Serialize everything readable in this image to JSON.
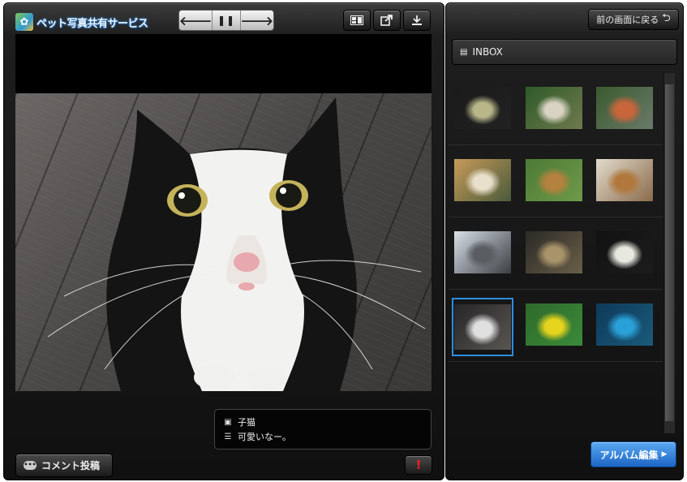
{
  "app": {
    "title": "ペット写真共有サービス"
  },
  "toolbar": {
    "prev_icon": "arrow-left-icon",
    "pause_icon": "pause-icon",
    "next_icon": "arrow-right-icon",
    "slideshow_icon": "slideshow-icon",
    "share_icon": "share-icon",
    "download_icon": "download-icon"
  },
  "photo": {
    "title": "子猫",
    "description": "可愛いなー。"
  },
  "footer": {
    "comment_label": "コメント投稿",
    "alert_label": "!"
  },
  "sidebar": {
    "back_label": "前の画面に戻る",
    "folder_label": "INBOX",
    "album_edit_label": "アルバム編集"
  },
  "thumbnails": [
    {
      "subject": "fish-tank-side",
      "colors": [
        "#1a1a1a",
        "#b9b78a",
        "#222"
      ],
      "selected": false
    },
    {
      "subject": "fish",
      "colors": [
        "#2f5a28",
        "#d8d3c2",
        "#6f7a4e"
      ],
      "selected": false
    },
    {
      "subject": "aquarium",
      "colors": [
        "#3a5a2e",
        "#c8653a",
        "#6a7a6a"
      ],
      "selected": false
    },
    {
      "subject": "dog",
      "colors": [
        "#c79a5a",
        "#e8e0cc",
        "#4a5a3a"
      ],
      "selected": false
    },
    {
      "subject": "dog-grass",
      "colors": [
        "#4c7a34",
        "#b4813e",
        "#6e9a4a"
      ],
      "selected": false
    },
    {
      "subject": "dog-standing",
      "colors": [
        "#e2dccc",
        "#b1773c",
        "#8a6a4a"
      ],
      "selected": false
    },
    {
      "subject": "cat-window",
      "colors": [
        "#d8e0e8",
        "#5a5e62",
        "#3a3e42"
      ],
      "selected": false
    },
    {
      "subject": "cat-tabby",
      "colors": [
        "#2a2a26",
        "#a8936a",
        "#6a5e48"
      ],
      "selected": false
    },
    {
      "subject": "cat-black",
      "colors": [
        "#111111",
        "#e8e8e0",
        "#1c1c1c"
      ],
      "selected": false
    },
    {
      "subject": "kitten",
      "colors": [
        "#262626",
        "#e0e0e0",
        "#5a5552"
      ],
      "selected": true
    },
    {
      "subject": "bird-yellow",
      "colors": [
        "#2e6a2a",
        "#e6d41e",
        "#3a8a3a"
      ],
      "selected": false
    },
    {
      "subject": "bird-blue",
      "colors": [
        "#0e3a5a",
        "#2aa0d8",
        "#1a5a7a"
      ],
      "selected": false
    }
  ],
  "colors": {
    "accent": "#2a8fe0",
    "alert": "#ff2020"
  }
}
